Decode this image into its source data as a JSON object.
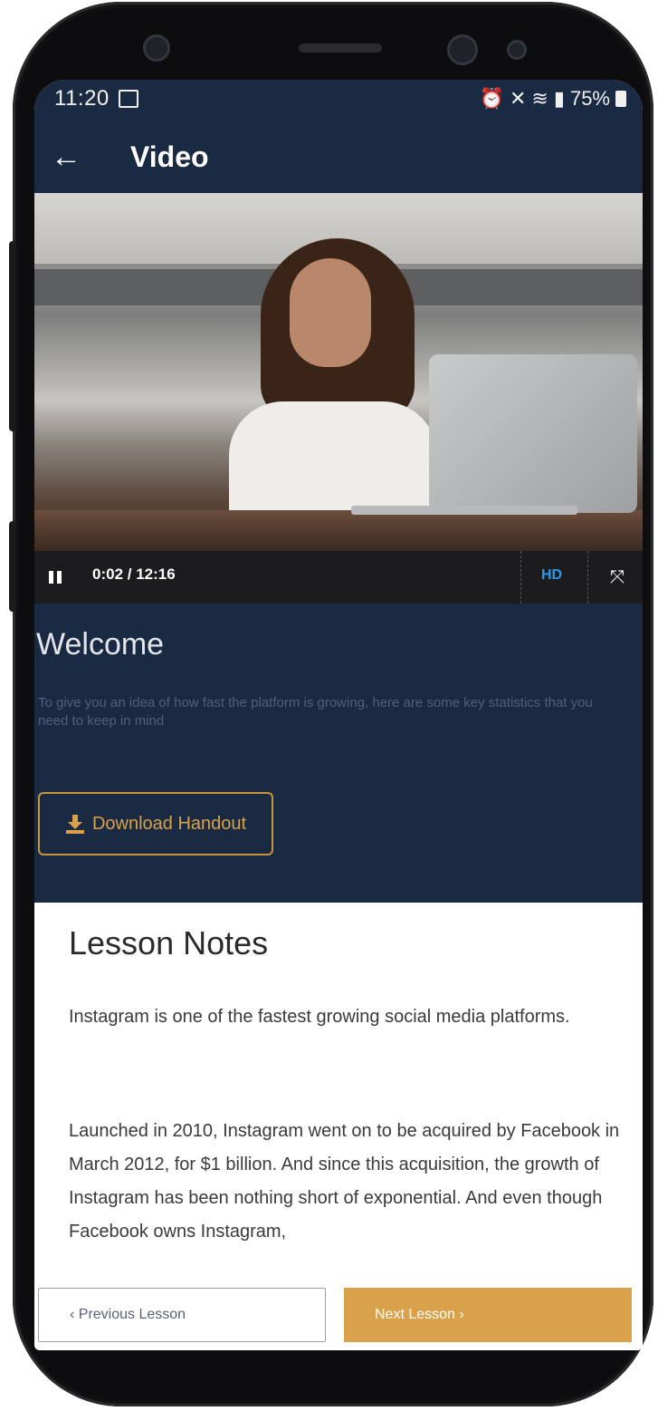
{
  "status_bar": {
    "time": "11:20",
    "icons": [
      "gallery-icon",
      "alarm-icon",
      "mute-icon",
      "wifi-icon",
      "signal-icon"
    ],
    "battery": "75%"
  },
  "app_bar": {
    "back_icon": "←",
    "title": "Video"
  },
  "player": {
    "time": "0:02 / 12:16",
    "quality": "HD",
    "fullscreen_icon": "⤧"
  },
  "lesson": {
    "title": "Welcome",
    "description": "To give you an idea of how fast the platform is growing, here are some key statistics that you need to keep in mind",
    "download_label": "Download Handout"
  },
  "notes": {
    "heading": "Lesson Notes",
    "paragraph1": "Instagram is one of the fastest growing social media platforms.",
    "paragraph2": "Launched in 2010, Instagram went on to be acquired by Facebook in March 2012, for $1 billion. And since this acquisition, the growth of Instagram has been nothing short of exponential. And even though Facebook owns Instagram,"
  },
  "navigation": {
    "previous_label": "‹ Previous Lesson",
    "next_label": "Next Lesson ›"
  },
  "colors": {
    "header": "#1a2a42",
    "accent": "#d9a24a",
    "hd": "#2b97e6"
  }
}
